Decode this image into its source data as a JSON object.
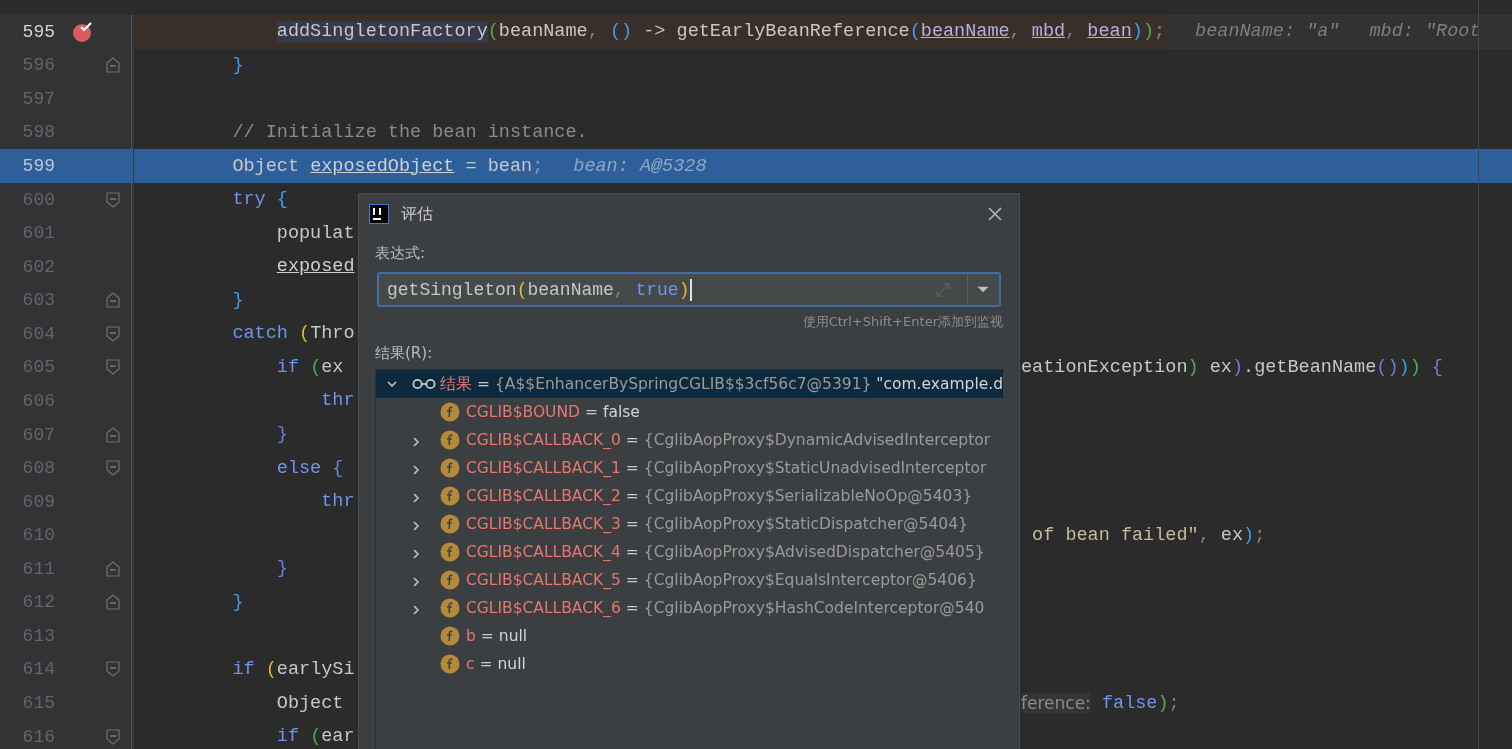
{
  "editor": {
    "lines": [
      {
        "children": [
          {
            "number": "595",
            "current": true,
            "breakpoint": true,
            "selected": false,
            "fold_start": false,
            "fold_end": false,
            "left": [
              {
                "text": "addSingletonFactory",
                "kind": "sel"
              },
              {
                "text": "(",
                "kind": "p2"
              },
              {
                "text": "beanName",
                "kind": "plain"
              },
              {
                "text": ", ",
                "kind": "punct"
              },
              {
                "text": "()",
                "kind": "p3"
              },
              {
                "text": " -> getEarlyBeanReference",
                "kind": "plain"
              },
              {
                "text": "(",
                "kind": "p3"
              },
              {
                "text": "beanName",
                "kind": "field"
              },
              {
                "text": ", ",
                "kind": "punct"
              },
              {
                "text": "mbd",
                "kind": "field"
              },
              {
                "text": ", ",
                "kind": "punct"
              },
              {
                "text": "bean",
                "kind": "field"
              },
              {
                "text": ")",
                "kind": "p3"
              },
              {
                "text": ")",
                "kind": "p2"
              },
              {
                "text": ";",
                "kind": "punct"
              },
              {
                "text": "beanName: \"a\"",
                "kind": "hint"
              },
              {
                "text": "mbd: \"Root",
                "kind": "hint"
              }
            ]
          }
        ]
      },
      {
        "number": "596",
        "current": false,
        "breakpoint": false,
        "selected": false,
        "fold_start": false,
        "fold_end": true,
        "left": [
          {
            "text": "}",
            "kind": "p3"
          }
        ]
      },
      {
        "number": "597",
        "current": false,
        "breakpoint": false,
        "selected": false,
        "fold_start": false,
        "fold_end": false
      },
      {
        "number": "598",
        "current": false,
        "breakpoint": false,
        "selected": false,
        "fold_start": false,
        "fold_end": false,
        "left": [
          {
            "text": "// Initialize the bean instance.",
            "kind": "comment"
          }
        ]
      },
      {
        "number": "599",
        "current": false,
        "breakpoint": false,
        "selected": true,
        "fold_start": false,
        "fold_end": false,
        "left": [
          {
            "text": "Object ",
            "kind": "plain"
          },
          {
            "text": "exposedObject",
            "kind": "under"
          },
          {
            "text": " = bean",
            "kind": "plain"
          },
          {
            "text": ";",
            "kind": "punct"
          },
          {
            "text": "bean: A@5328",
            "kind": "hint"
          }
        ]
      },
      {
        "number": "600",
        "current": false,
        "breakpoint": false,
        "selected": false,
        "fold_start": true,
        "fold_end": false,
        "left": [
          {
            "text": "try",
            "kind": "kw"
          },
          {
            "text": " {",
            "kind": "p3"
          }
        ]
      },
      {
        "children": [
          {
            "number": "601",
            "current": false,
            "breakpoint": false,
            "selected": false,
            "fold_start": false,
            "fold_end": false,
            "left": [
              {
                "text": "populat",
                "kind": "plain"
              }
            ]
          },
          {
            "number": "602",
            "current": false,
            "breakpoint": false,
            "selected": false,
            "fold_start": false,
            "fold_end": false,
            "left": [
              {
                "text": "exposed",
                "kind": "under"
              }
            ]
          }
        ]
      },
      {
        "number": "603",
        "current": false,
        "breakpoint": false,
        "selected": false,
        "fold_start": false,
        "fold_end": true,
        "left": [
          {
            "text": "}",
            "kind": "p3"
          }
        ]
      },
      {
        "number": "604",
        "current": false,
        "breakpoint": false,
        "selected": false,
        "fold_start": true,
        "fold_end": false,
        "left": [
          {
            "text": "catch ",
            "kind": "kw"
          },
          {
            "text": "(",
            "kind": "p1"
          },
          {
            "text": "Thro",
            "kind": "plain"
          }
        ]
      },
      {
        "children": [
          {
            "number": "605",
            "current": false,
            "breakpoint": false,
            "selected": false,
            "fold_start": true,
            "fold_end": false,
            "left": [
              {
                "text": "if ",
                "kind": "kw"
              },
              {
                "text": "(",
                "kind": "p2"
              },
              {
                "text": "ex",
                "kind": "plain"
              }
            ],
            "right": [
              {
                "text": "eationException",
                "kind": "plain"
              },
              {
                "text": ")",
                "kind": "p2"
              },
              {
                "text": " ex",
                "kind": "plain"
              },
              {
                "text": ")",
                "kind": "p4"
              },
              {
                "text": ".getBeanName",
                "kind": "plain"
              },
              {
                "text": "()",
                "kind": "p4"
              },
              {
                "text": ")",
                "kind": "p3"
              },
              {
                "text": ")",
                "kind": "p2"
              },
              {
                "text": " {",
                "kind": "p4"
              }
            ]
          },
          {
            "children": [
              {
                "number": "606",
                "current": false,
                "breakpoint": false,
                "selected": false,
                "fold_start": false,
                "fold_end": false,
                "left": [
                  {
                    "text": "thr",
                    "kind": "kw"
                  }
                ]
              }
            ]
          },
          {
            "number": "607",
            "current": false,
            "breakpoint": false,
            "selected": false,
            "fold_start": false,
            "fold_end": true,
            "left": [
              {
                "text": "}",
                "kind": "p4"
              }
            ]
          },
          {
            "number": "608",
            "current": false,
            "breakpoint": false,
            "selected": false,
            "fold_start": true,
            "fold_end": false,
            "left": [
              {
                "text": "else",
                "kind": "kw"
              },
              {
                "text": " {",
                "kind": "p4"
              }
            ]
          },
          {
            "children": [
              {
                "number": "609",
                "current": false,
                "breakpoint": false,
                "selected": false,
                "fold_start": false,
                "fold_end": false,
                "left": [
                  {
                    "text": "thr",
                    "kind": "kw"
                  }
                ]
              }
            ]
          },
          {
            "number": "610",
            "current": false,
            "breakpoint": false,
            "selected": false,
            "fold_start": false,
            "fold_end": false,
            "right": [
              {
                "text": " of bean failed\"",
                "kind": "str"
              },
              {
                "text": ", ",
                "kind": "punct"
              },
              {
                "text": "ex",
                "kind": "plain"
              },
              {
                "text": ")",
                "kind": "p3"
              },
              {
                "text": ";",
                "kind": "punct"
              }
            ]
          },
          {
            "number": "611",
            "current": false,
            "breakpoint": false,
            "selected": false,
            "fold_start": false,
            "fold_end": true,
            "left": [
              {
                "text": "}",
                "kind": "p4"
              }
            ]
          }
        ]
      },
      {
        "number": "612",
        "current": false,
        "breakpoint": false,
        "selected": false,
        "fold_start": false,
        "fold_end": true,
        "left": [
          {
            "text": "}",
            "kind": "p3"
          }
        ]
      },
      {
        "number": "613",
        "current": false,
        "breakpoint": false,
        "selected": false,
        "fold_start": false,
        "fold_end": false
      },
      {
        "number": "614",
        "current": false,
        "breakpoint": false,
        "selected": false,
        "fold_start": true,
        "fold_end": false,
        "left": [
          {
            "text": "if ",
            "kind": "kw"
          },
          {
            "text": "(",
            "kind": "p1"
          },
          {
            "text": "earlySi",
            "kind": "plain"
          }
        ]
      },
      {
        "children": [
          {
            "number": "615",
            "current": false,
            "breakpoint": false,
            "selected": false,
            "fold_start": false,
            "fold_end": false,
            "left": [
              {
                "text": "Object",
                "kind": "plain"
              }
            ],
            "right": [
              {
                "text": "ference:",
                "kind": "hint2"
              },
              {
                "text": " false",
                "kind": "kw"
              },
              {
                "text": ")",
                "kind": "p2"
              },
              {
                "text": ";",
                "kind": "punct"
              }
            ]
          },
          {
            "number": "616",
            "current": false,
            "breakpoint": false,
            "selected": false,
            "fold_start": true,
            "fold_end": false,
            "left": [
              {
                "text": "if ",
                "kind": "kw"
              },
              {
                "text": "(",
                "kind": "p2"
              },
              {
                "text": "ear",
                "kind": "plain"
              }
            ]
          }
        ]
      }
    ]
  },
  "dialog": {
    "title": "评估",
    "expression_label": "表达式:",
    "expression": [
      {
        "text": "getSingleton",
        "kind": "plain"
      },
      {
        "text": "(",
        "kind": "p1"
      },
      {
        "text": "beanName",
        "kind": "plain"
      },
      {
        "text": ", ",
        "kind": "punct"
      },
      {
        "text": "true",
        "kind": "kw"
      },
      {
        "text": ")",
        "kind": "p1"
      }
    ],
    "hint": "使用Ctrl+Shift+Enter添加到监视",
    "result_label": "结果(R):",
    "result": {
      "name": "结果",
      "operator": "=",
      "value": "{A$$EnhancerBySpringCGLIB$$3cf56c7@5391}",
      "extra": "\"com.example.d",
      "expanded": true,
      "selected": true,
      "children": [
        {
          "name": "CGLIB$BOUND",
          "operator": "=",
          "value": "false",
          "kind": "literal",
          "expandable": false
        },
        {
          "name": "CGLIB$CALLBACK_0",
          "operator": "=",
          "value": "{CglibAopProxy$DynamicAdvisedInterceptor",
          "kind": "ref",
          "expandable": true
        },
        {
          "name": "CGLIB$CALLBACK_1",
          "operator": "=",
          "value": "{CglibAopProxy$StaticUnadvisedInterceptor",
          "kind": "ref",
          "expandable": true
        },
        {
          "name": "CGLIB$CALLBACK_2",
          "operator": "=",
          "value": "{CglibAopProxy$SerializableNoOp@5403}",
          "kind": "ref",
          "expandable": true
        },
        {
          "name": "CGLIB$CALLBACK_3",
          "operator": "=",
          "value": "{CglibAopProxy$StaticDispatcher@5404}",
          "kind": "ref",
          "expandable": true
        },
        {
          "name": "CGLIB$CALLBACK_4",
          "operator": "=",
          "value": "{CglibAopProxy$AdvisedDispatcher@5405}",
          "kind": "ref",
          "expandable": true
        },
        {
          "name": "CGLIB$CALLBACK_5",
          "operator": "=",
          "value": "{CglibAopProxy$EqualsInterceptor@5406}",
          "kind": "ref",
          "expandable": true
        },
        {
          "name": "CGLIB$CALLBACK_6",
          "operator": "=",
          "value": "{CglibAopProxy$HashCodeInterceptor@540",
          "kind": "ref",
          "expandable": true
        },
        {
          "name": "b",
          "operator": "=",
          "value": "null",
          "kind": "literal",
          "expandable": false
        },
        {
          "name": "c",
          "operator": "=",
          "value": "null",
          "kind": "literal",
          "expandable": false
        }
      ]
    }
  }
}
